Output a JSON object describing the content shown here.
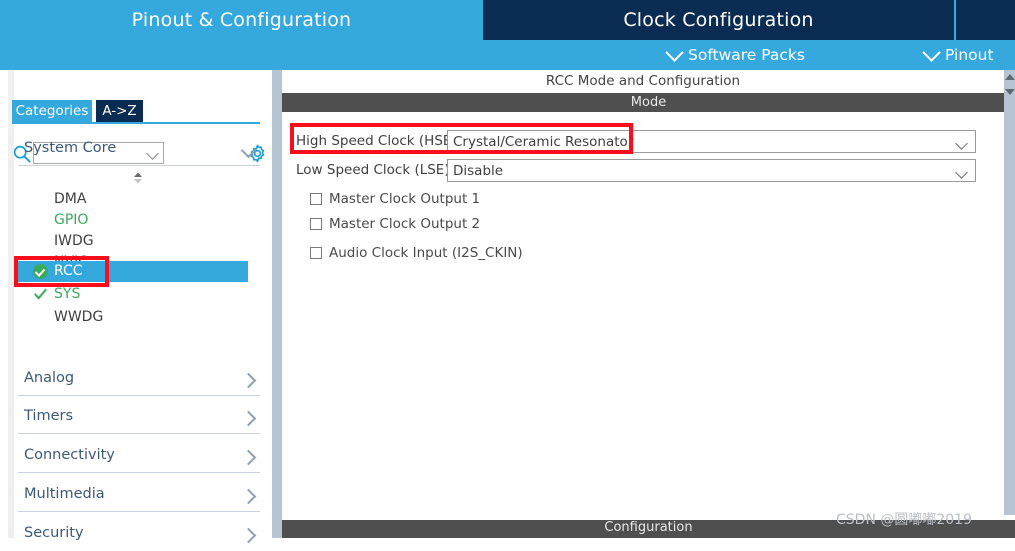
{
  "tabs": {
    "pinout_configuration": "Pinout & Configuration",
    "clock_configuration": "Clock Configuration",
    "extra": ""
  },
  "subbar": {
    "software_packs": "Software Packs",
    "pinout": "Pinout"
  },
  "sidebar": {
    "search": {
      "value": "",
      "placeholder": ""
    },
    "minitabs": {
      "categories": "Categories",
      "az": "A->Z"
    },
    "expanded_category": {
      "label": "System Core",
      "state": "expanded"
    },
    "items": [
      {
        "label": "DMA",
        "status": "none",
        "selected": false
      },
      {
        "label": "GPIO",
        "status": "green",
        "selected": false
      },
      {
        "label": "IWDG",
        "status": "none",
        "selected": false
      },
      {
        "label": "NVIC",
        "status": "none",
        "selected": false
      },
      {
        "label": "RCC",
        "status": "checked",
        "selected": true
      },
      {
        "label": "SYS",
        "status": "check",
        "selected": false
      },
      {
        "label": "WWDG",
        "status": "none",
        "selected": false
      }
    ],
    "categories": [
      {
        "label": "Analog",
        "state": "collapsed"
      },
      {
        "label": "Timers",
        "state": "collapsed"
      },
      {
        "label": "Connectivity",
        "state": "collapsed"
      },
      {
        "label": "Multimedia",
        "state": "collapsed"
      },
      {
        "label": "Security",
        "state": "collapsed"
      }
    ]
  },
  "main": {
    "panel_title": "RCC Mode and Configuration",
    "mode_header": "Mode",
    "bottom_header": "Configuration",
    "fields": [
      {
        "label": "High Speed Clock (HSE)",
        "value": "Crystal/Ceramic Resonator"
      },
      {
        "label": "Low Speed Clock (LSE)",
        "value": "Disable"
      }
    ],
    "checkboxes": [
      {
        "label": "Master Clock Output 1",
        "checked": false
      },
      {
        "label": "Master Clock Output 2",
        "checked": false
      },
      {
        "label": "Audio Clock Input (I2S_CKIN)",
        "checked": false
      }
    ]
  },
  "annotations": {
    "color": "#fc0d1b",
    "boxes": [
      "rcc-tree-item",
      "high-speed-clock-hse-field"
    ]
  },
  "watermark": "CSDN @圆嘟嘟2019",
  "colors": {
    "accent_blue": "#35a8dd",
    "dark_navy": "#0b2c52",
    "mode_bar_gray": "#4f4f4f",
    "splitter": "#b6c5d1",
    "green_status": "#3aaa5d",
    "annotation_red": "#fc0d1b"
  }
}
